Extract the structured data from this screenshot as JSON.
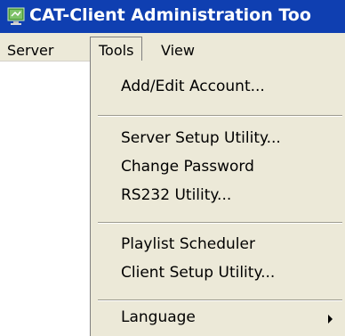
{
  "window": {
    "title": "CAT-Client Administration Too",
    "icon": "monitor-app-icon",
    "title_bar_color": "#0f3fb1"
  },
  "menubar": {
    "items": [
      {
        "label": "Server"
      },
      {
        "label": "Tools"
      },
      {
        "label": "View"
      }
    ]
  },
  "tools_menu": {
    "items": [
      {
        "label": "Add/Edit Account..."
      },
      {
        "label": "Server Setup Utility..."
      },
      {
        "label": "Change Password"
      },
      {
        "label": "RS232 Utility..."
      },
      {
        "label": "Playlist Scheduler"
      },
      {
        "label": "Client Setup Utility..."
      },
      {
        "label": "Language"
      }
    ],
    "submenu_icon": "chevron-right-icon"
  }
}
